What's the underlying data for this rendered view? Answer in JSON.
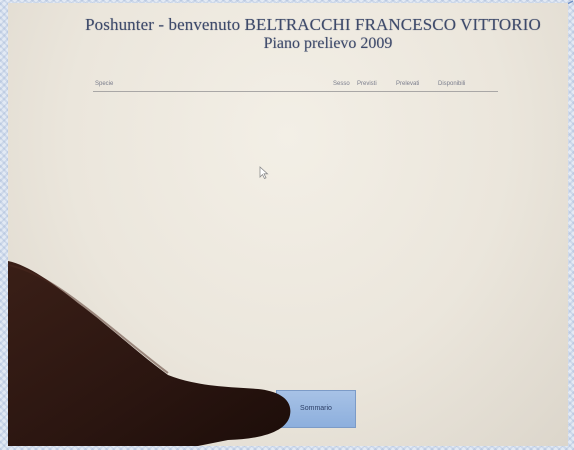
{
  "header": {
    "title": "Poshunter - benvenuto BELTRACCHI FRANCESCO VITTORIO",
    "subtitle": "Piano prelievo 2009"
  },
  "table": {
    "columns": [
      "Specie",
      "Sesso",
      "Previsti",
      "Prelevati",
      "Disponibili"
    ],
    "rows": []
  },
  "actions": {
    "summary_button": "Sommario"
  },
  "colors": {
    "title_text": "#3e4a6a",
    "button_bg": "#9bb9e2",
    "frame": "#e3eaf4"
  },
  "icons": {
    "cursor": "mouse-pointer-icon"
  }
}
